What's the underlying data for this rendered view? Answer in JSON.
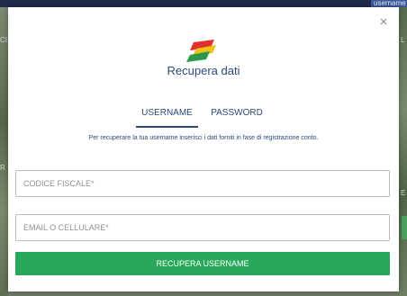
{
  "background": {
    "user_label": "username",
    "letters": [
      "CI",
      "R",
      "L",
      "E"
    ]
  },
  "modal": {
    "close_symbol": "×",
    "title": "Recupera dati",
    "tabs": [
      {
        "label": "USERNAME",
        "active": true
      },
      {
        "label": "PASSWORD",
        "active": false
      }
    ],
    "hint": "Per recuperare la tua username inserisci i dati forniti in fase di registrazione conto.",
    "fields": {
      "codice_fiscale": {
        "placeholder": "CODICE FISCALE*",
        "value": ""
      },
      "email": {
        "placeholder": "EMAIL O CELLULARE*",
        "value": ""
      }
    },
    "submit_label": "RECUPERA USERNAME"
  },
  "colors": {
    "primary_text": "#2a4a78",
    "submit_green": "#27a85a",
    "logo_red": "#e0312a",
    "logo_yellow": "#f2c21b",
    "logo_green": "#2a9a4a"
  },
  "icons": [
    "close-icon",
    "brand-logo-icon"
  ]
}
